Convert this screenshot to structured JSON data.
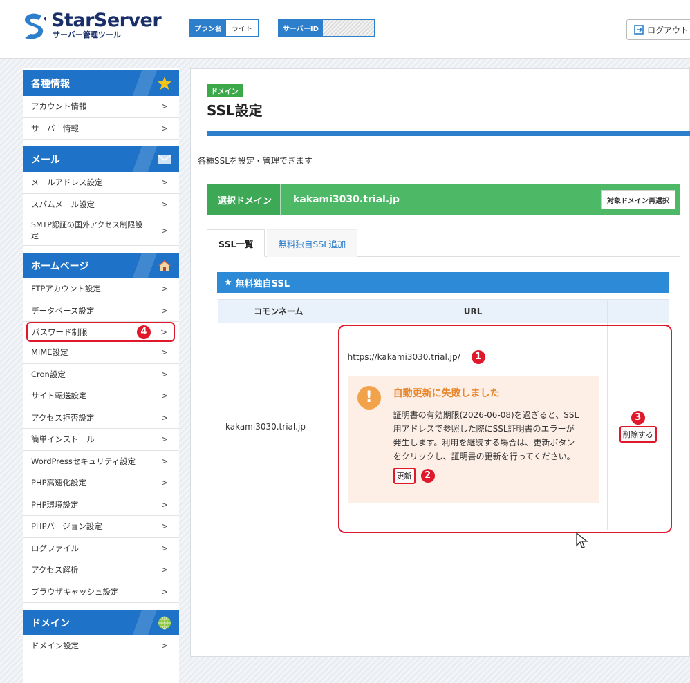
{
  "header": {
    "logo_title": "StarServer",
    "logo_sub": "サーバー管理ツール",
    "plan_label": "プラン名",
    "plan_value": "ライト",
    "server_label": "サーバーID",
    "logout": "ログアウト"
  },
  "sidebar": {
    "sections": [
      {
        "title": "各種情報",
        "icon": "star-icon",
        "items": [
          "アカウント情報",
          "サーバー情報"
        ]
      },
      {
        "title": "メール",
        "icon": "mail-icon",
        "items": [
          "メールアドレス設定",
          "スパムメール設定",
          "SMTP認証の国外アクセス制限設定"
        ]
      },
      {
        "title": "ホームページ",
        "icon": "home-icon",
        "items": [
          "FTPアカウント設定",
          "データベース設定",
          "パスワード制限",
          "MIME設定",
          "Cron設定",
          "サイト転送設定",
          "アクセス拒否設定",
          "簡単インストール",
          "WordPressセキュリティ設定",
          "PHP高速化設定",
          "PHP環境設定",
          "PHPバージョン設定",
          "ログファイル",
          "アクセス解析",
          "ブラウザキャッシュ設定"
        ]
      },
      {
        "title": "ドメイン",
        "icon": "globe-icon",
        "items": [
          "ドメイン設定"
        ]
      }
    ],
    "highlight_badge": "4"
  },
  "main": {
    "category": "ドメイン",
    "title": "SSL設定",
    "description": "各種SSLを設定・管理できます",
    "domain_label": "選択ドメイン",
    "domain_value": "kakami3030.trial.jp",
    "reselect": "対象ドメイン再選択",
    "tabs": [
      "SSL一覧",
      "無料独自SSL追加"
    ],
    "ssl_section": "無料独自SSL",
    "columns": [
      "コモンネーム",
      "URL",
      ""
    ],
    "row": {
      "common_name": "kakami3030.trial.jp",
      "url": "https://kakami3030.trial.jp/",
      "url_badge": "1",
      "alert_title": "自動更新に失敗しました",
      "alert_message": "証明書の有効期限(2026-06-08)を過ぎると、SSL用アドレスで参照した際にSSL証明書のエラーが発生します。利用を継続する場合は、更新ボタンをクリックし、証明書の更新を行ってください。",
      "renew": "更新",
      "renew_badge": "2",
      "delete": "削除する",
      "delete_badge": "3"
    }
  },
  "colors": {
    "primary": "#2d7ecb",
    "green": "#4db865",
    "highlight": "#e0182c",
    "alert": "#e8862a"
  }
}
